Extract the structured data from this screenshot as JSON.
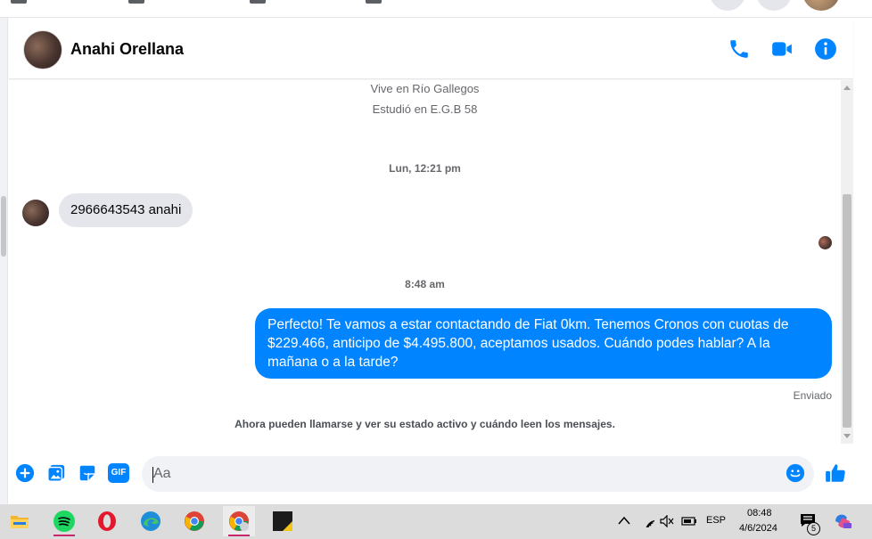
{
  "contact": {
    "name": "Anahi Orellana"
  },
  "profile_info": {
    "lives": "Vive en Río Gallegos",
    "studied": "Estudió en E.G.B 58"
  },
  "messages": [
    {
      "time": "Lun, 12:21 pm",
      "text": "2966643543 anahi",
      "direction": "incoming"
    },
    {
      "time": "8:48 am",
      "text": "Perfecto! Te vamos a estar contactando de Fiat 0km. Tenemos Cronos con cuotas de $229.466, anticipo de $4.495.800, aceptamos usados. Cuándo podes hablar? A la mañana o a la tarde?",
      "direction": "outgoing",
      "status": "Enviado"
    }
  ],
  "footer_note": "Ahora pueden llamarse y ver su estado activo y cuándo leen los mensajes.",
  "composer": {
    "placeholder": "Aa",
    "gif_label": "GIF"
  },
  "header_icons": [
    "phone-icon",
    "video-icon",
    "info-icon"
  ],
  "composer_icons": [
    "plus-icon",
    "image-icon",
    "sticker-icon",
    "gif-icon",
    "emoji-icon",
    "like-icon"
  ],
  "taskbar": {
    "apps": [
      "file-explorer-icon",
      "spotify-icon",
      "opera-icon",
      "edge-icon",
      "chrome-icon",
      "chrome-profile-icon",
      "sticky-app-icon"
    ],
    "lang": "ESP",
    "time": "08:48",
    "date": "4/6/2024",
    "notification_count": "5"
  },
  "colors": {
    "accent": "#0084ff",
    "incoming_bubble": "#e4e6eb",
    "taskbar": "#dcdcdc"
  }
}
